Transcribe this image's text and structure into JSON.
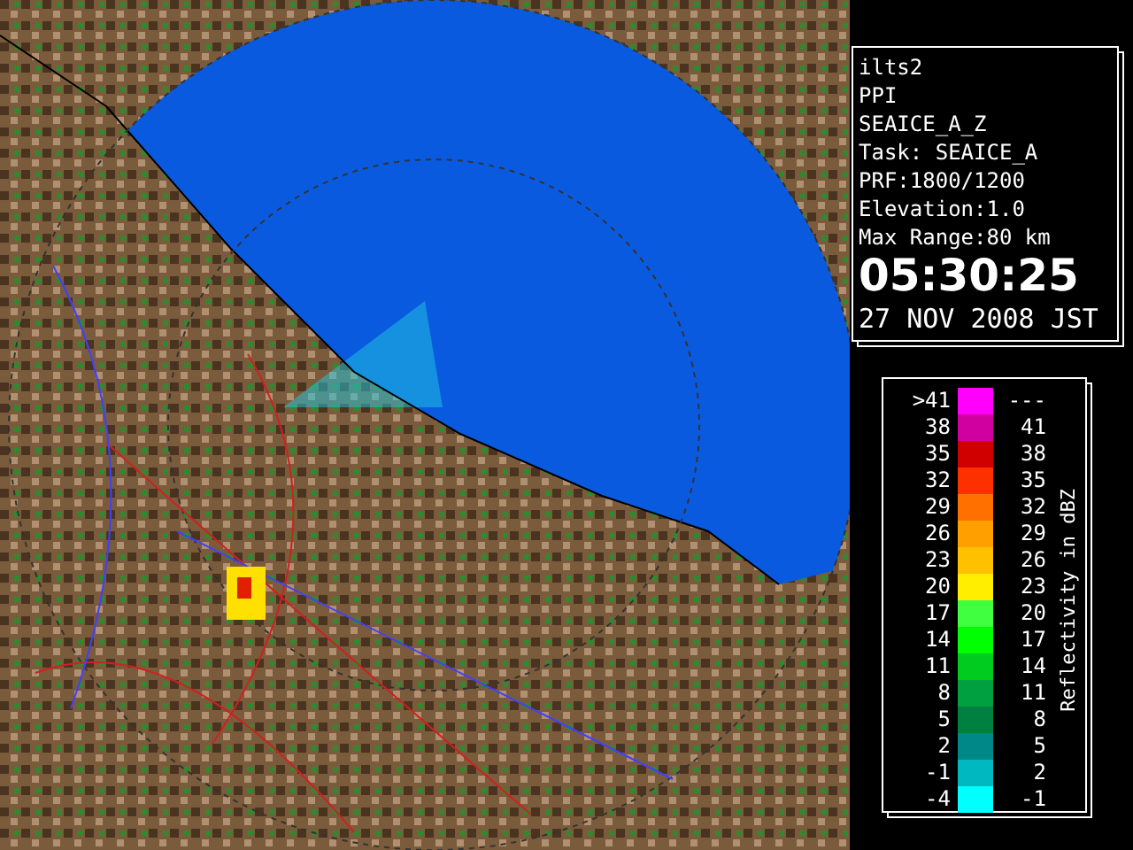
{
  "info_panel": {
    "lines": [
      "ilts2",
      "PPI",
      "SEAICE_A_Z",
      "Task: SEAICE_A",
      "PRF:1800/1200",
      "Elevation:1.0",
      "Max Range:80 km"
    ],
    "time": "05:30:25",
    "date": "27 NOV 2008 JST"
  },
  "legend": {
    "title": "Reflectivity in dBZ",
    "rows": [
      {
        "low": ">41",
        "high": "---",
        "color": "#ff00ff"
      },
      {
        "low": "38",
        "high": "41",
        "color": "#d000a0"
      },
      {
        "low": "35",
        "high": "38",
        "color": "#d00000"
      },
      {
        "low": "32",
        "high": "35",
        "color": "#ff3000"
      },
      {
        "low": "29",
        "high": "32",
        "color": "#ff7000"
      },
      {
        "low": "26",
        "high": "29",
        "color": "#ffa000"
      },
      {
        "low": "23",
        "high": "26",
        "color": "#ffc000"
      },
      {
        "low": "20",
        "high": "23",
        "color": "#ffee00"
      },
      {
        "low": "17",
        "high": "20",
        "color": "#40ff40"
      },
      {
        "low": "14",
        "high": "17",
        "color": "#00ff00"
      },
      {
        "low": "11",
        "high": "14",
        "color": "#00cc20"
      },
      {
        "low": "8",
        "high": "11",
        "color": "#00a040"
      },
      {
        "low": "5",
        "high": "8",
        "color": "#008040"
      },
      {
        "low": "2",
        "high": "5",
        "color": "#008888"
      },
      {
        "low": "-1",
        "high": "2",
        "color": "#00b8c0"
      },
      {
        "low": "-4",
        "high": "-1",
        "color": "#00ffff"
      }
    ]
  }
}
